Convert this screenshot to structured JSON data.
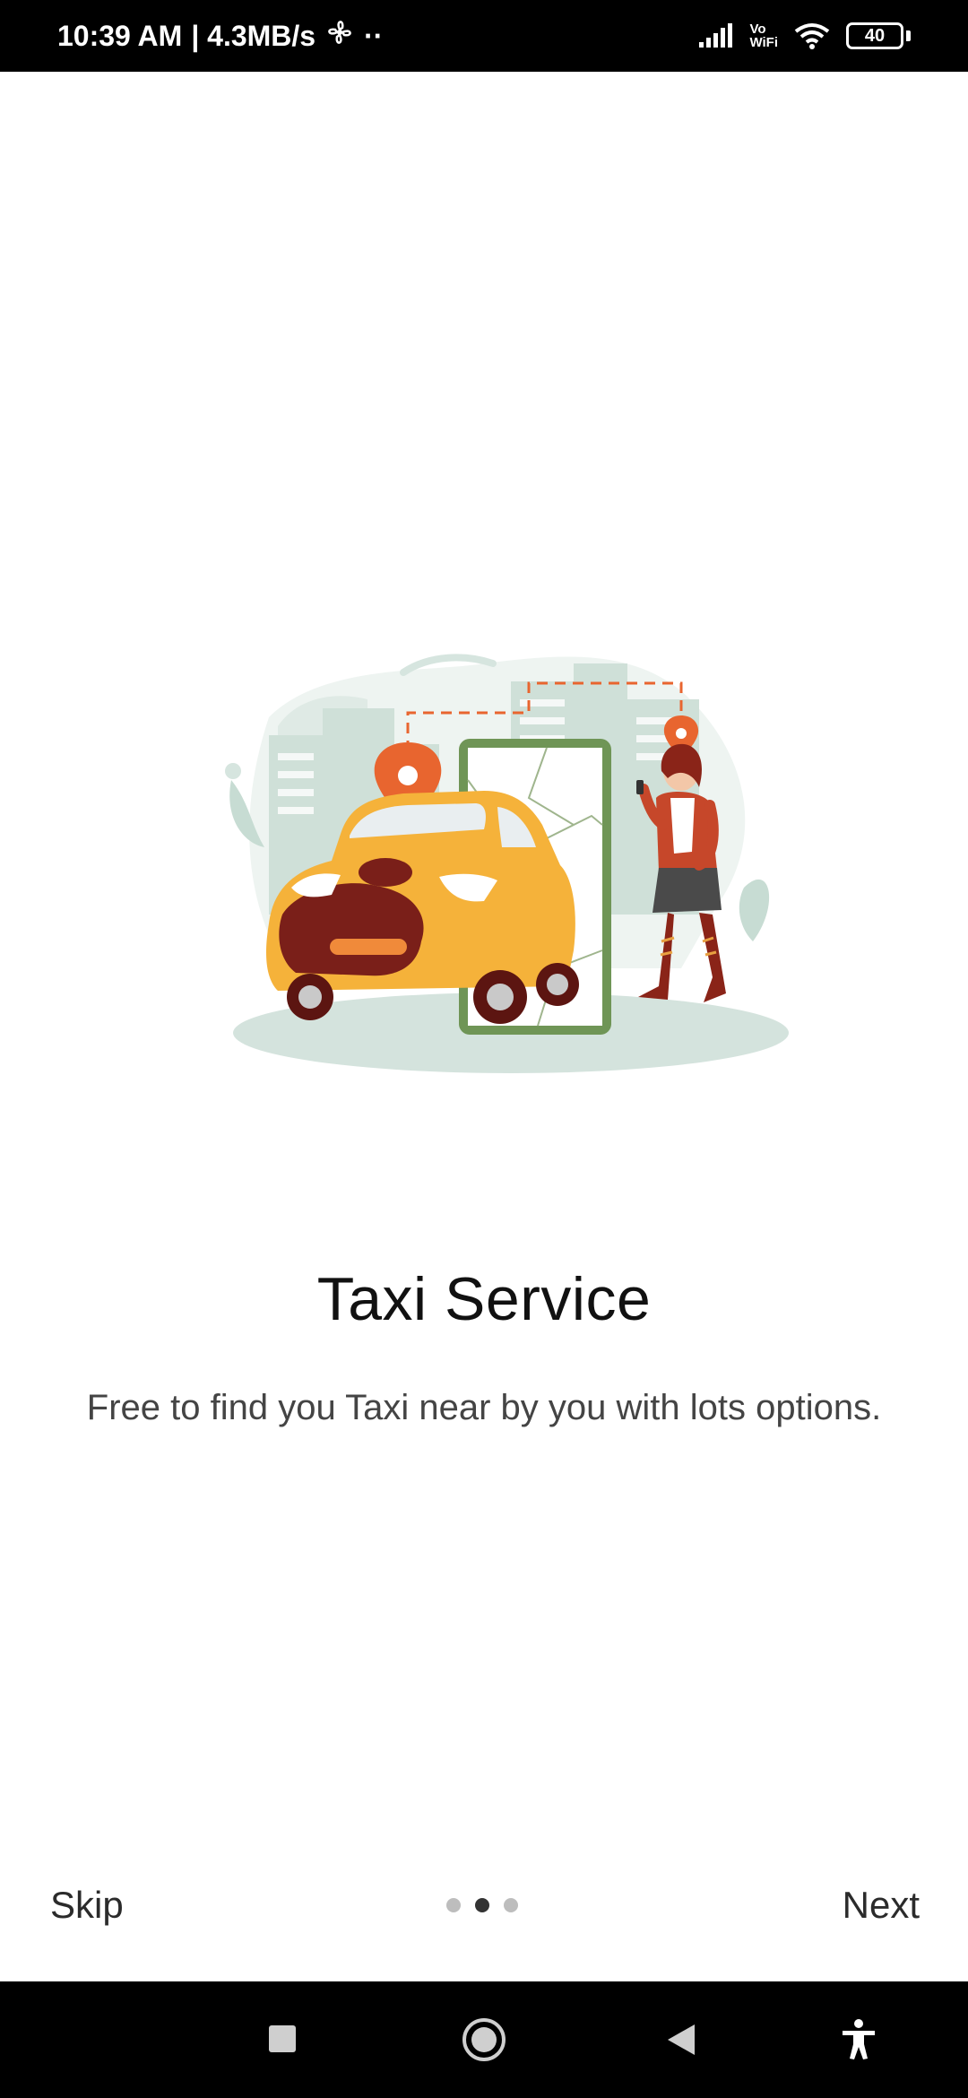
{
  "status_bar": {
    "time": "10:39 AM",
    "speed": "| 4.3MB/s",
    "extra": "··",
    "vowifi_top": "Vo",
    "vowifi_bottom": "WiFi",
    "battery": "40"
  },
  "onboarding": {
    "title": "Taxi Service",
    "description": "Free to find you Taxi near by you with lots options.",
    "skip_label": "Skip",
    "next_label": "Next",
    "page_index": 2,
    "page_count": 3
  },
  "nav_bar": {
    "icons": [
      "square-recents-icon",
      "circle-home-icon",
      "triangle-back-icon",
      "accessibility-icon"
    ]
  },
  "colors": {
    "accent_orange": "#e8652f",
    "car_yellow": "#f5b23a",
    "map_green": "#6f9556",
    "mint": "#d6e5df"
  }
}
